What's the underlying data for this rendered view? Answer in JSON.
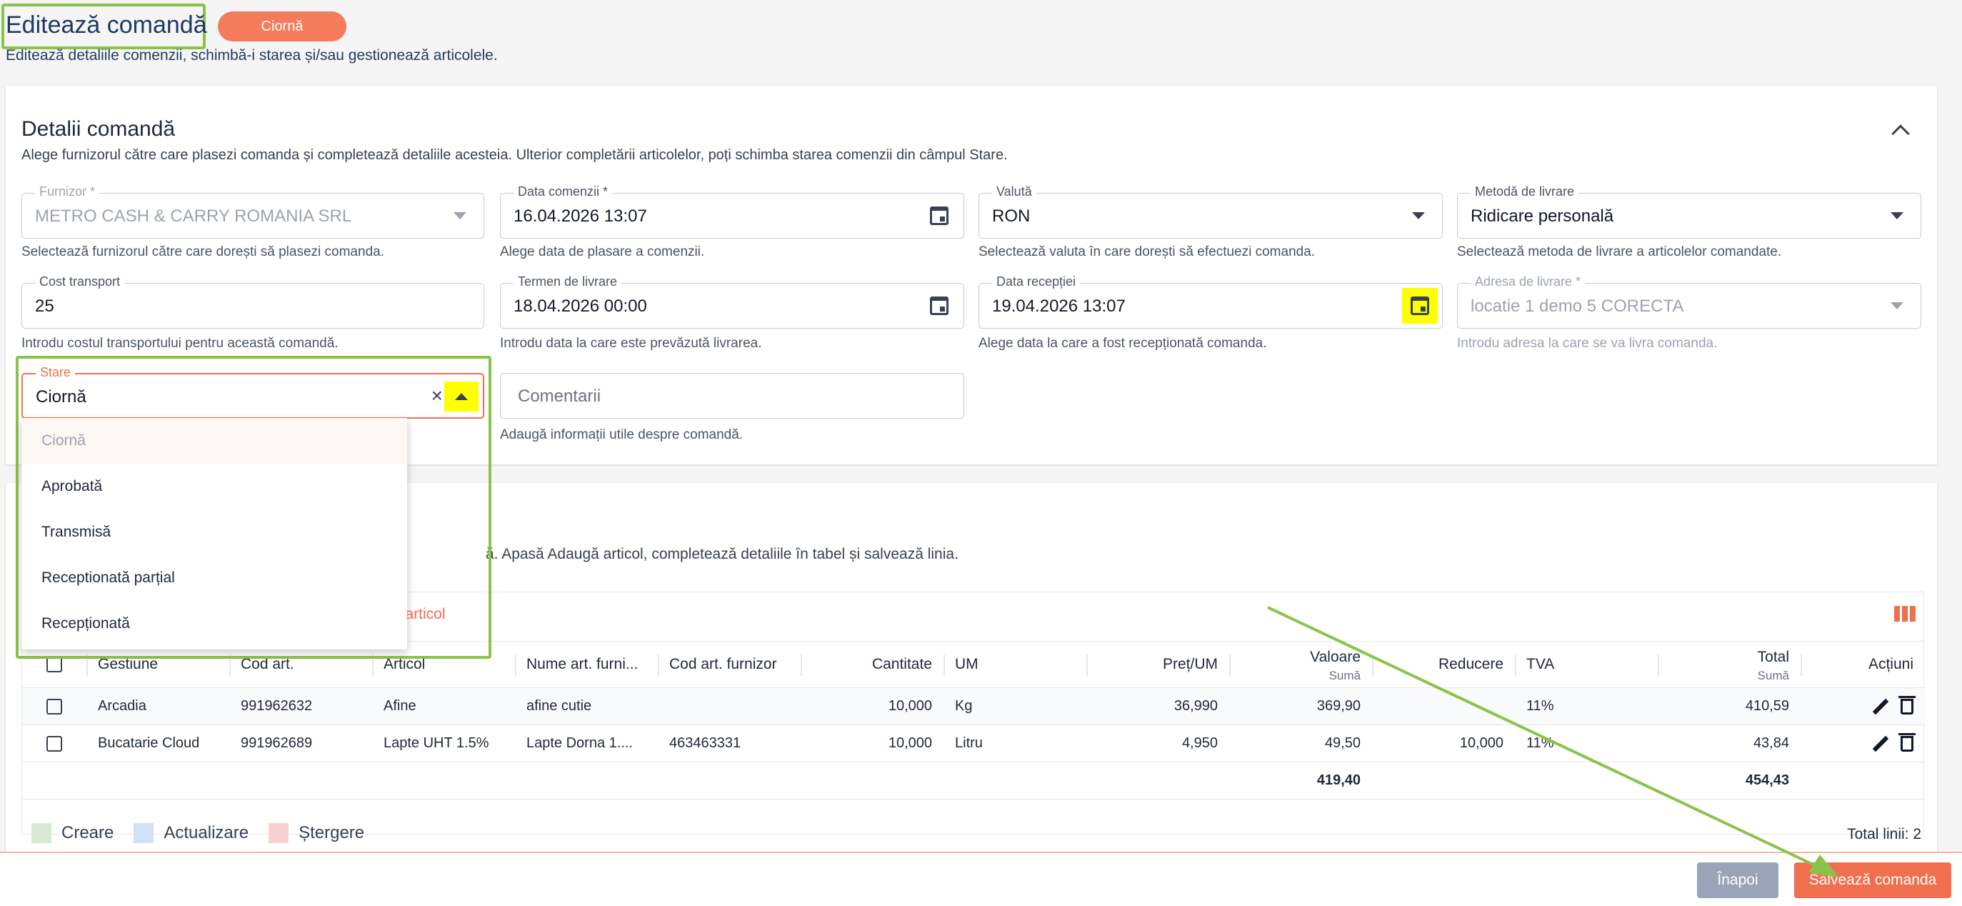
{
  "header": {
    "title": "Editează comandă",
    "status": "Ciornă",
    "subtitle": "Editează detaliile comenzii, schimbă-i starea și/sau gestionează articolele."
  },
  "details": {
    "title": "Detalii comandă",
    "description": "Alege furnizorul către care plasezi comanda și completează detaliile acesteia. Ulterior completării articolelor, poți schimba starea comenzii din câmpul Stare.",
    "furnizor": {
      "label": "Furnizor *",
      "value": "METRO CASH & CARRY ROMANIA SRL",
      "help": "Selectează furnizorul către care dorești să plasezi comanda."
    },
    "data_comenzii": {
      "label": "Data comenzii *",
      "value": "16.04.2026 13:07",
      "help": "Alege data de plasare a comenzii."
    },
    "valuta": {
      "label": "Valută",
      "value": "RON",
      "help": "Selectează valuta în care dorești să efectuezi comanda."
    },
    "metoda_livrare": {
      "label": "Metodă de livrare",
      "value": "Ridicare personală",
      "help": "Selectează metoda de livrare a articolelor comandate."
    },
    "cost_transport": {
      "label": "Cost transport",
      "value": "25",
      "help": "Introdu costul transportului pentru această comandă."
    },
    "termen_livrare": {
      "label": "Termen de livrare",
      "value": "18.04.2026 00:00",
      "help": "Introdu data la care este prevăzută livrarea."
    },
    "data_receptiei": {
      "label": "Data recepției",
      "value": "19.04.2026 13:07",
      "help": "Alege data la care a fost recepționată comanda."
    },
    "adresa_livrare": {
      "label": "Adresa de livrare *",
      "value": "locatie 1 demo 5 CORECTA",
      "help": "Introdu adresa la care se va livra comanda."
    },
    "stare": {
      "label": "Stare",
      "value": "Ciornă"
    },
    "comentarii": {
      "placeholder": "Comentarii",
      "help": "Adaugă informații utile despre comandă."
    }
  },
  "stare_options": [
    "Ciornă",
    "Aprobată",
    "Transmisă",
    "Receptionată parțial",
    "Recepționată"
  ],
  "articles": {
    "description": "ă. Apasă Adaugă articol, completează detaliile în tabel și salvează linia.",
    "add_label": "a articol",
    "headers": {
      "gestiune": "Gestiune",
      "cod_art": "Cod art.",
      "articol": "Articol",
      "nume_furn": "Nume art. furni...",
      "cod_furn": "Cod art. furnizor",
      "cantitate": "Cantitate",
      "um": "UM",
      "pret": "Preț/UM",
      "valoare": "Valoare",
      "valoare_sub": "Sumă",
      "reducere": "Reducere",
      "tva": "TVA",
      "total": "Total",
      "total_sub": "Sumă",
      "actiuni": "Acțiuni"
    },
    "rows": [
      {
        "gestiune": "Arcadia",
        "cod_art": "991962632",
        "articol": "Afine",
        "nume_furn": "afine cutie",
        "cod_furn": "",
        "cantitate": "10,000",
        "um": "Kg",
        "pret": "36,990",
        "valoare": "369,90",
        "reducere": "",
        "tva": "11%",
        "total": "410,59"
      },
      {
        "gestiune": "Bucatarie Cloud",
        "cod_art": "991962689",
        "articol": "Lapte UHT 1.5%",
        "nume_furn": "Lapte Dorna 1....",
        "cod_furn": "463463331",
        "cantitate": "10,000",
        "um": "Litru",
        "pret": "4,950",
        "valoare": "49,50",
        "reducere": "10,000",
        "tva": "11%",
        "total": "43,84"
      }
    ],
    "totals": {
      "valoare": "419,40",
      "total": "454,43"
    },
    "legend": {
      "creare": "Creare",
      "actualizare": "Actualizare",
      "stergere": "Ștergere"
    },
    "total_lines": "Total linii: 2"
  },
  "footer": {
    "back": "Înapoi",
    "save": "Salvează comanda"
  },
  "colors": {
    "accent": "#f06f4f",
    "highlight": "#ffff00",
    "annotation": "#8bc34a",
    "legend_create": "#d9ead3",
    "legend_update": "#cfe2f3",
    "legend_delete": "#f8d0d0"
  }
}
